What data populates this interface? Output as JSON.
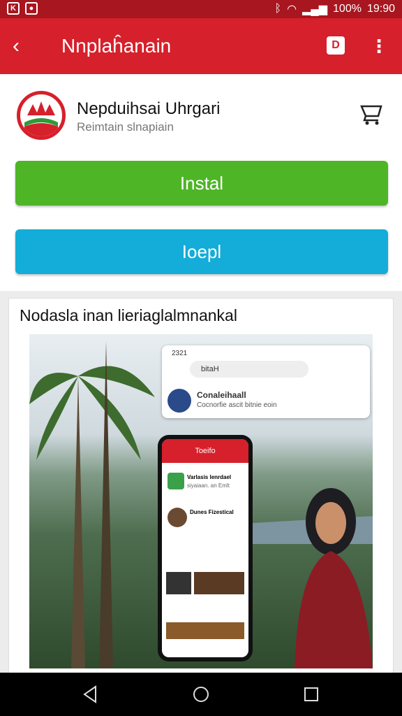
{
  "status_bar": {
    "time": "19:90",
    "battery": "100%"
  },
  "app_bar": {
    "title": "Nnplaĥanain",
    "back_icon": "arrow-back-icon",
    "badge_icon": "d-badge-icon",
    "menu_icon": "more-vert-icon"
  },
  "app": {
    "name": "Nepduihsai Uhrgari",
    "subtitle": "Reimtain slnapiain",
    "logo_icon": "crown-logo-icon",
    "wishlist_icon": "cart-icon"
  },
  "buttons": {
    "install_label": "Instal",
    "open_label": "Ioepl",
    "install_color": "#4eb527",
    "open_color": "#14acd8"
  },
  "screenshot": {
    "title": "Nodasla inan lieriaglalmnankal",
    "mini_header": {
      "time": "2321",
      "search_text": "bitaH",
      "profile_name": "Conaleihaall",
      "profile_sub": "Cocnorfie ascit bitnie eoin"
    },
    "phone": {
      "title": "Toeifo",
      "post_title": "Varlasis lenrdael",
      "post_sub": "siyaiaan. an Emlt",
      "item_title": "Dunes Fizestical"
    }
  },
  "colors": {
    "brand_red": "#d6202b",
    "status_red": "#a8161f"
  }
}
